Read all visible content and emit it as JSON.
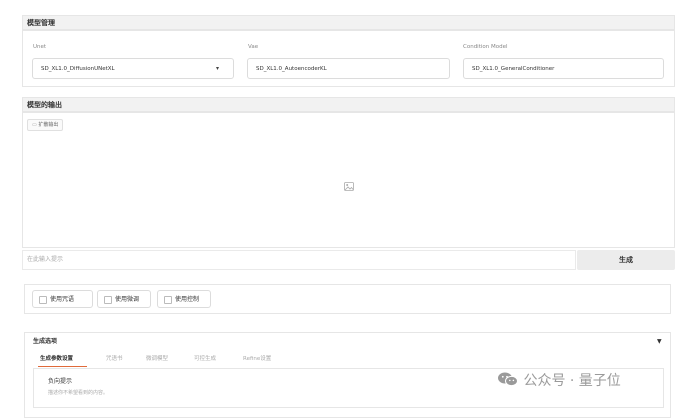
{
  "model_management": {
    "title": "模型管理",
    "unet": {
      "label": "Unet",
      "value": "SD_XL1.0_DiffusionUNetXL"
    },
    "vae": {
      "label": "Vae",
      "value": "SD_XL1.0_AutoencoderKL"
    },
    "condition": {
      "label": "Condition Model",
      "value": "SD_XL1.0_GeneralConditioner"
    }
  },
  "output": {
    "title": "模型的输出",
    "expand_label": "扩散输出",
    "image_icon": "image-icon"
  },
  "prompt": {
    "placeholder": "在此输入提示",
    "generate_label": "生成"
  },
  "options": [
    {
      "label": "使用咒语"
    },
    {
      "label": "使用微调"
    },
    {
      "label": "使用控制"
    }
  ],
  "generation_options": {
    "title": "生成选项",
    "collapse_icon": "▼",
    "tabs": [
      {
        "label": "生成参数设置"
      },
      {
        "label": "咒语书"
      },
      {
        "label": "微调模型"
      },
      {
        "label": "可控生成"
      },
      {
        "label": "Refine设置"
      }
    ],
    "negative_prompt": {
      "label": "负向提示",
      "placeholder": "描述你不希望看到的内容。"
    }
  },
  "watermark": {
    "brand": "公众号 · 量子位"
  },
  "colors": {
    "header_bg": "#f2f2f2",
    "button_bg": "#ececec",
    "border": "#e6e6e6"
  }
}
